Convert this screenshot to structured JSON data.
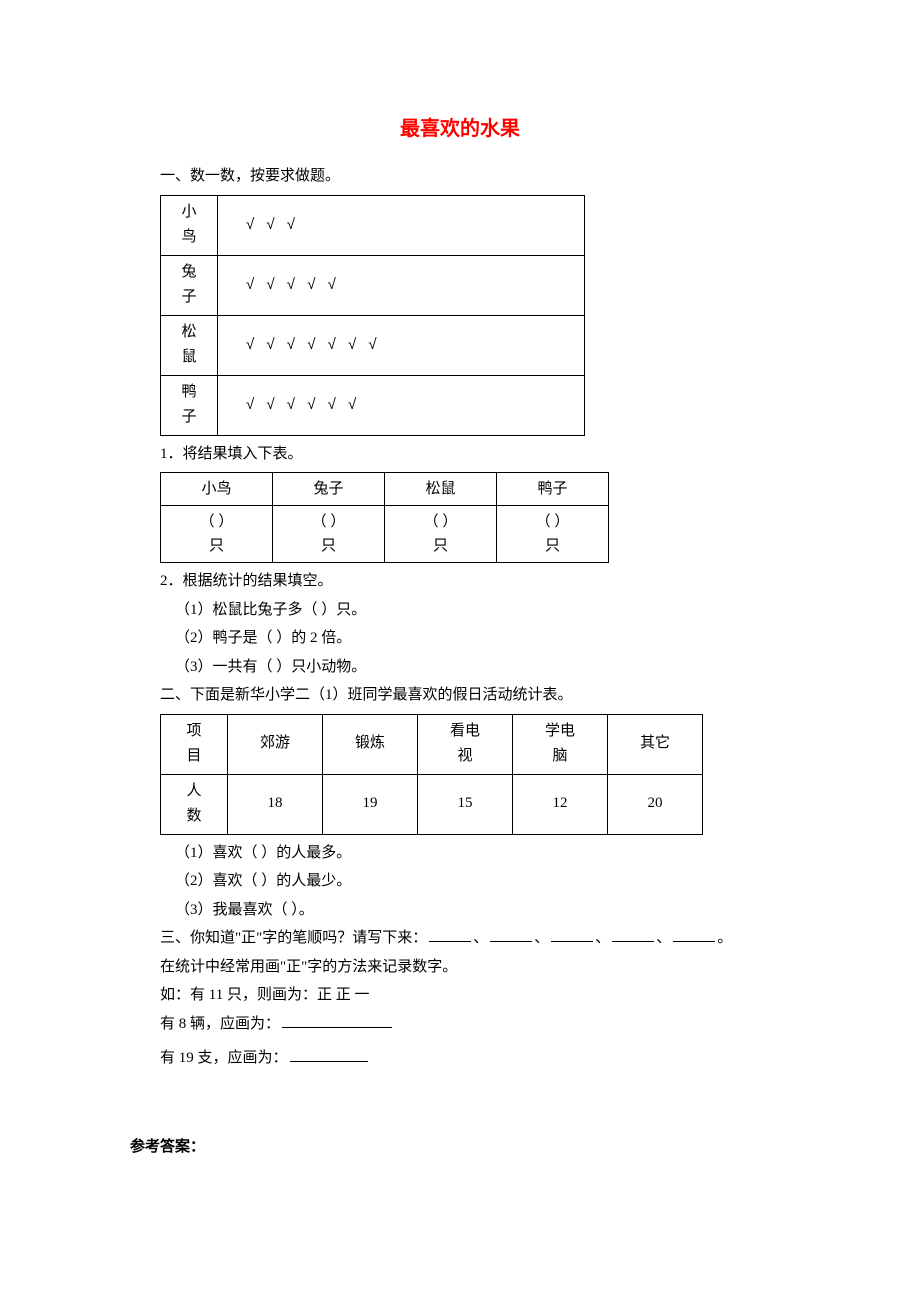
{
  "title": "最喜欢的水果",
  "s1": {
    "heading": "一、数一数，按要求做题。",
    "rows": [
      {
        "name": "小\n鸟",
        "ticks": "√  √  √"
      },
      {
        "name": "兔\n子",
        "ticks": "√  √  √  √  √"
      },
      {
        "name": "松\n鼠",
        "ticks": "√  √  √ √  √  √  √"
      },
      {
        "name": "鸭\n子",
        "ticks": "√  √  √ √  √  √"
      }
    ],
    "q1": "1．将结果填入下表。",
    "t2_headers": [
      "小鸟",
      "兔子",
      "松鼠",
      "鸭子"
    ],
    "cell_blank": "（    ）\n只",
    "q2": "2．根据统计的结果填空。",
    "q2_1": "（1）松鼠比兔子多（     ）只。",
    "q2_2": "（2）鸭子是（     ）的 2 倍。",
    "q2_3": "（3）一共有（     ）只小动物。"
  },
  "s2": {
    "heading": "二、下面是新华小学二（1）班同学最喜欢的假日活动统计表。",
    "row1": [
      "项\n目",
      "郊游",
      "锻炼",
      "看电\n视",
      "学电\n脑",
      "其它"
    ],
    "row2": [
      "人\n数",
      "18",
      "19",
      "15",
      "12",
      "20"
    ],
    "q1": "（1）喜欢（     ）的人最多。",
    "q2": "（2）喜欢（     ）的人最少。",
    "q3": "（3）我最喜欢（            ）。"
  },
  "s3": {
    "heading_pre": "三、你知道\"正\"字的笔顺吗？请写下来：",
    "sep": "、",
    "end": "。",
    "line2": "在统计中经常用画\"正\"字的方法来记录数字。",
    "line3": "如：有 11 只，则画为：正  正   一",
    "line4": "有 8 辆，应画为：",
    "line5": "有 19 支，应画为："
  },
  "answer_h": "参考答案："
}
